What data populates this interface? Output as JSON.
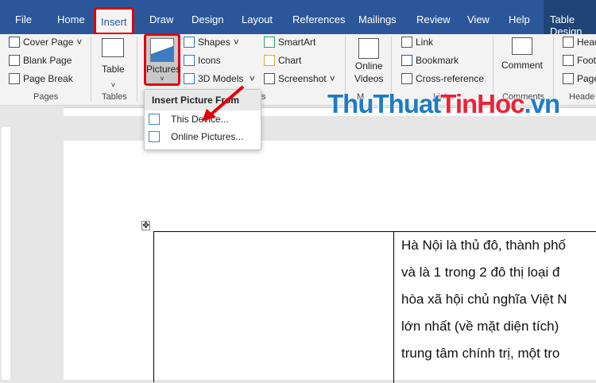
{
  "tabs": [
    "File",
    "Home",
    "Insert",
    "Draw",
    "Design",
    "Layout",
    "References",
    "Mailings",
    "Review",
    "View",
    "Help",
    "Table Design"
  ],
  "ribbon": {
    "pages": {
      "items": [
        "Cover Page",
        "Blank Page",
        "Page Break"
      ],
      "label": "Pages"
    },
    "tables": {
      "item": "Table",
      "label": "Tables"
    },
    "illustrations": {
      "pictures": "Pictures",
      "items": [
        "Shapes",
        "Icons",
        "3D Models"
      ],
      "items2": [
        "SmartArt",
        "Chart",
        "Screenshot"
      ],
      "label": "s"
    },
    "media": {
      "item1": "Online",
      "item2": "Videos",
      "label": "M"
    },
    "links": {
      "items": [
        "Link",
        "Bookmark",
        "Cross-reference"
      ],
      "label": "Links"
    },
    "comments": {
      "item": "Comment",
      "label": "Comments"
    },
    "header": {
      "items": [
        "Head",
        "Foot",
        "Page"
      ],
      "label": "Heade"
    }
  },
  "menu": {
    "title": "Insert Picture From",
    "items": [
      "This Device...",
      "Online Pictures..."
    ]
  },
  "watermark": {
    "part1": "ThuThuat",
    "part2": "TinHoc",
    "part3": ".vn"
  },
  "document": {
    "lines": [
      "Hà Nội là thủ đô, thành phố",
      "và là 1 trong 2 đô thị loại đ",
      "hòa xã hội chủ nghĩa Việt N",
      "lớn nhất (về mặt diện tích)",
      "trung tâm chính trị, một tro"
    ]
  }
}
